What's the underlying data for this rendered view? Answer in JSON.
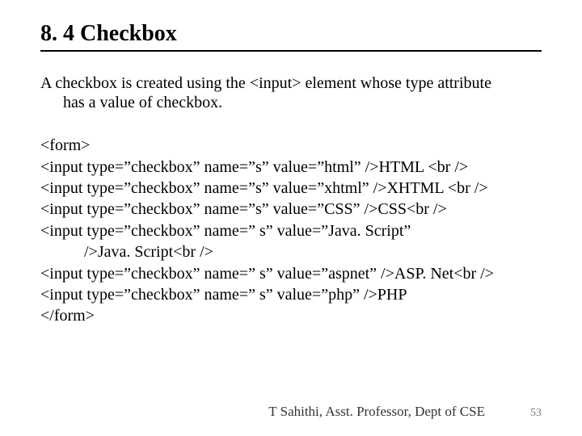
{
  "title": "8. 4 Checkbox",
  "description_line1": "A checkbox is created using the <input> element whose type attribute",
  "description_line2": "has a value of checkbox.",
  "code": {
    "l1": "<form>",
    "l2": "<input type=”checkbox” name=”s” value=”html” />HTML <br />",
    "l3": "<input type=”checkbox” name=”s” value=”xhtml” />XHTML <br />",
    "l4": "<input type=”checkbox” name=”s” value=”CSS” />CSS<br />",
    "l5a": "<input type=”checkbox” name=” s” value=”Java. Script”",
    "l5b": "/>Java. Script<br />",
    "l6": "<input type=”checkbox” name=” s” value=”aspnet” />ASP. Net<br />",
    "l7": "<input type=”checkbox” name=” s” value=”php” />PHP",
    "l8": "</form>"
  },
  "footer": {
    "author": "T Sahithi, Asst. Professor, Dept of CSE",
    "page": "53"
  }
}
